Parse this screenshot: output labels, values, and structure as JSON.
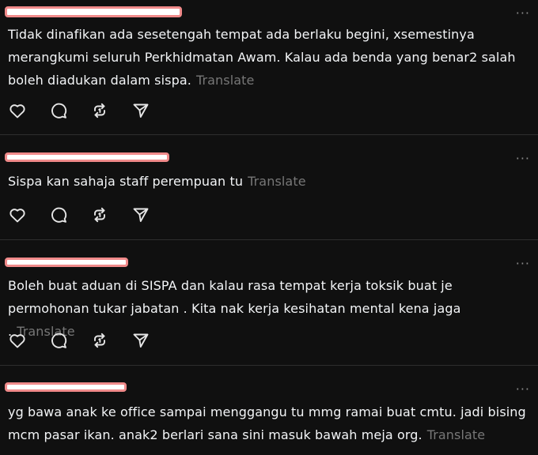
{
  "more_label": "···",
  "translate_label": "Translate",
  "icons": [
    "heart-icon",
    "comment-icon",
    "repost-icon",
    "share-icon"
  ],
  "posts": [
    {
      "text": "Tidak dinafikan ada sesetengah tempat ada berlaku begini, xsemestinya merangkumi seluruh Perkhidmatan Awam. Kalau ada benda yang benar2 salah boleh diadukan dalam sispa."
    },
    {
      "text": "Sispa kan sahaja staff perempuan tu"
    },
    {
      "text": "Boleh buat aduan di SISPA dan kalau rasa tempat kerja toksik buat je permohonan tukar jabatan . Kita nak kerja kesihatan mental kena jaga ."
    },
    {
      "text": "yg bawa anak ke office sampai menggangu tu mmg ramai buat cmtu. jadi bising mcm pasar ikan. anak2 berlari sana sini masuk bawah meja org."
    }
  ]
}
